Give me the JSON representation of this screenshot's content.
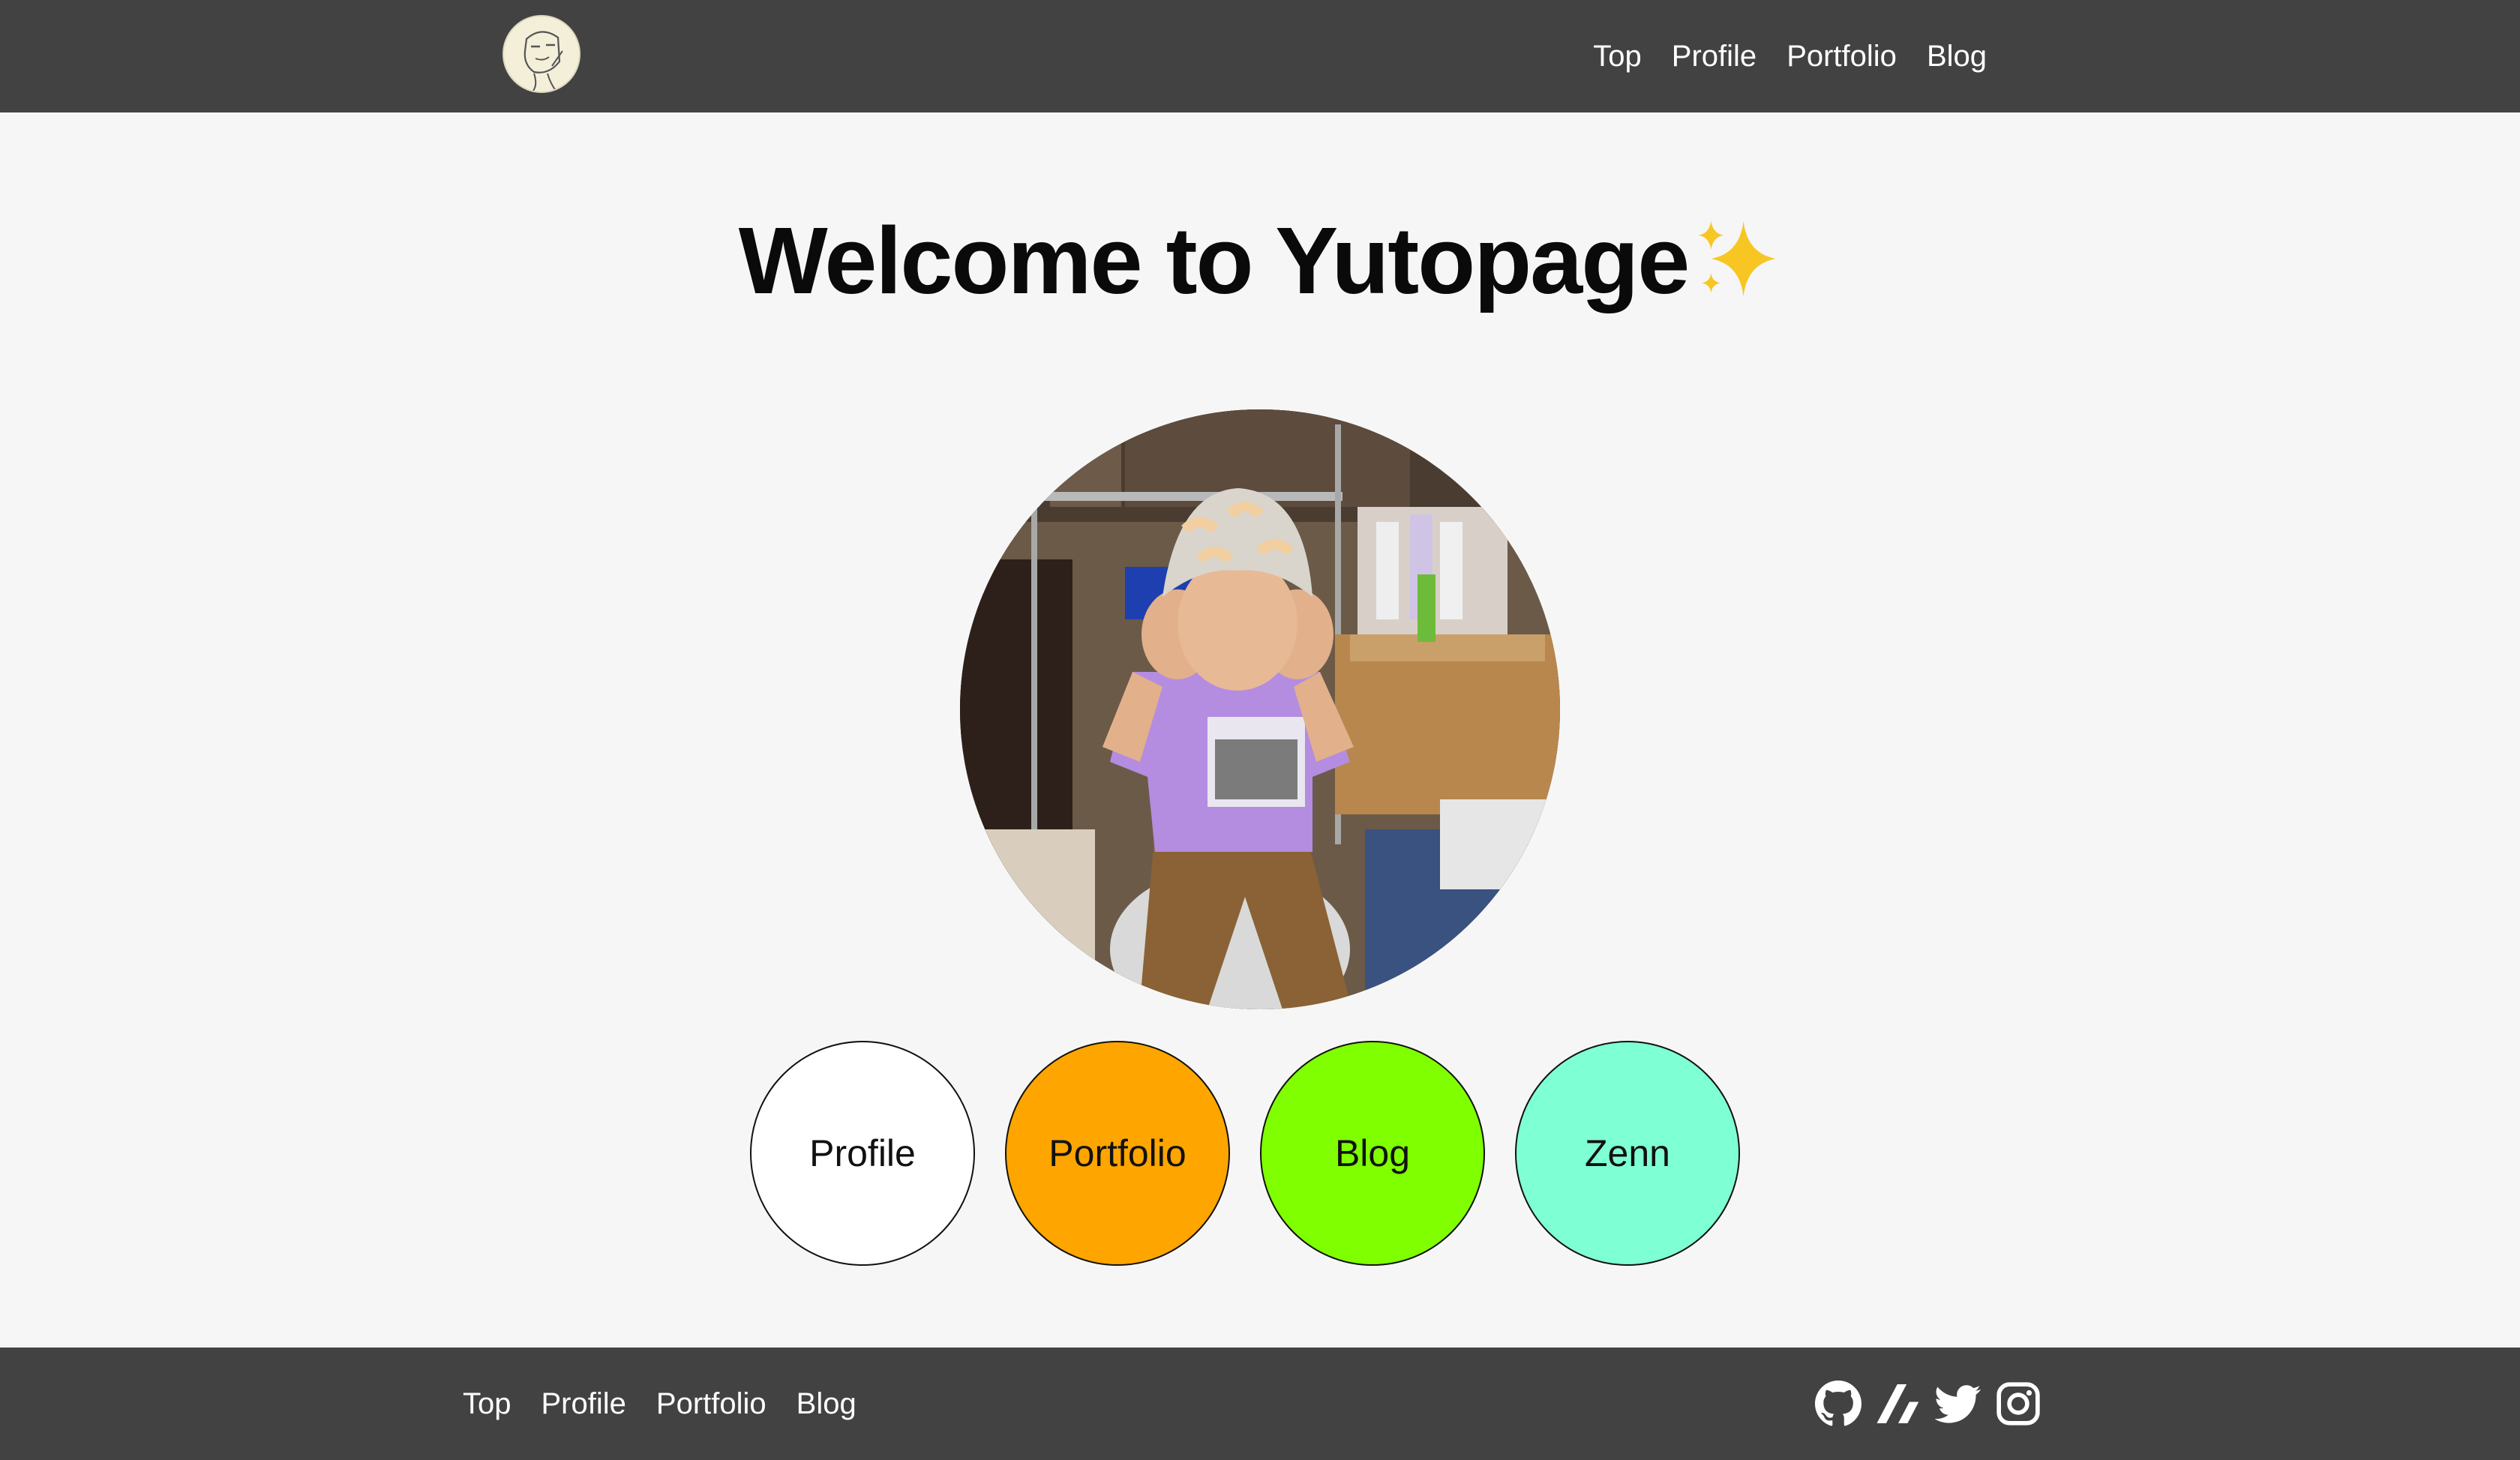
{
  "header": {
    "logo": "cartoon-face-logo",
    "nav": [
      "Top",
      "Profile",
      "Portfolio",
      "Blog"
    ]
  },
  "main": {
    "title": "Welcome to Yutopage",
    "title_emoji": "sparkles-icon",
    "photo": "profile-photo",
    "circle_buttons": [
      {
        "label": "Profile",
        "color": "#ffffff"
      },
      {
        "label": "Portfolio",
        "color": "#ffa500"
      },
      {
        "label": "Blog",
        "color": "#7fff00"
      },
      {
        "label": "Zenn",
        "color": "#7fffd4"
      }
    ]
  },
  "footer": {
    "nav": [
      "Top",
      "Profile",
      "Portfolio",
      "Blog"
    ],
    "social_icons": [
      "github-icon",
      "zenn-icon",
      "twitter-icon",
      "instagram-icon"
    ]
  },
  "colors": {
    "bar_background": "#424242",
    "page_background": "#f6f6f6",
    "sparkle": "#f7c623"
  }
}
